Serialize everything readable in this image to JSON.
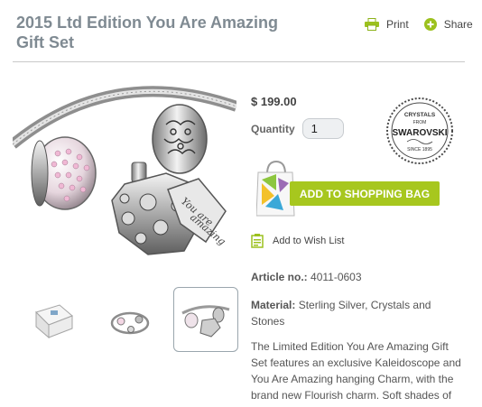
{
  "product": {
    "title_line1": "2015 Ltd Edition You Are Amazing",
    "title_line2": "Gift Set",
    "price": "$ 199.00",
    "quantity_label": "Quantity",
    "quantity_value": "1",
    "add_to_bag_label": "ADD TO SHOPPING BAG",
    "wishlist_label": "Add to Wish List",
    "article_label": "Article no.:",
    "article_value": "4011-0603",
    "material_label": "Material:",
    "material_value": "Sterling Silver, Crystals and Stones",
    "description_lines": [
      "The Limited Edition You Are Amazing Gift",
      "Set features an exclusive Kaleidoscope and",
      "You Are Amazing hanging Charm, with the",
      "brand new Flourish charm. Soft shades of"
    ]
  },
  "actions": {
    "print_label": "Print",
    "share_label": "Share"
  },
  "seal": {
    "top_text": "CRYSTALS",
    "from_text": "FROM",
    "brand": "SWAROVSKI",
    "since_text": "SINCE 1895"
  },
  "thumbnails": [
    {
      "icon": "gift-box-thumbnail",
      "active": false
    },
    {
      "icon": "bracelet-thumbnail",
      "active": false
    },
    {
      "icon": "charm-detail-thumbnail",
      "active": true
    }
  ],
  "colors": {
    "accent_green": "#a7c71e",
    "title_gray": "#7f8a92"
  }
}
